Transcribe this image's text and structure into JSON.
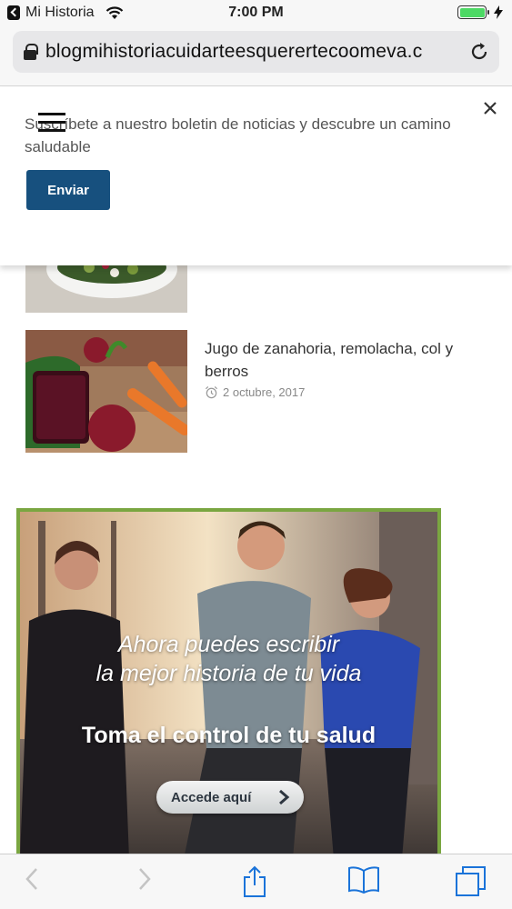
{
  "status_bar": {
    "back_app": "Mi Historia",
    "time": "7:00 PM",
    "battery_level": 1.0,
    "icons": [
      "back-arrow-icon",
      "wifi-icon",
      "battery-icon",
      "charging-bolt-icon"
    ]
  },
  "browser": {
    "url": "blogmihistoriacuidarteesquerertecoomeva.c",
    "icons": [
      "lock-icon",
      "reload-icon"
    ]
  },
  "newsletter": {
    "text": "Suscríbete a nuestro boletin de noticias y descubre un camino saludable",
    "submit_label": "Enviar",
    "icons": [
      "hamburger-menu-icon",
      "close-icon"
    ]
  },
  "article": {
    "title": "Jugo de zanahoria, remolacha, col y berros",
    "date": "2 octubre, 2017"
  },
  "banner": {
    "line1": "Ahora puedes escribir",
    "line2": "la mejor historia de tu vida",
    "heading": "Toma el control de tu salud",
    "cta_label": "Accede aquí",
    "border_color": "#7aa641"
  },
  "toolbar": {
    "icons": [
      "back-icon",
      "forward-icon",
      "share-icon",
      "bookmarks-icon",
      "tabs-icon"
    ]
  },
  "colors": {
    "button": "#17507e",
    "battery": "#4cd964"
  }
}
